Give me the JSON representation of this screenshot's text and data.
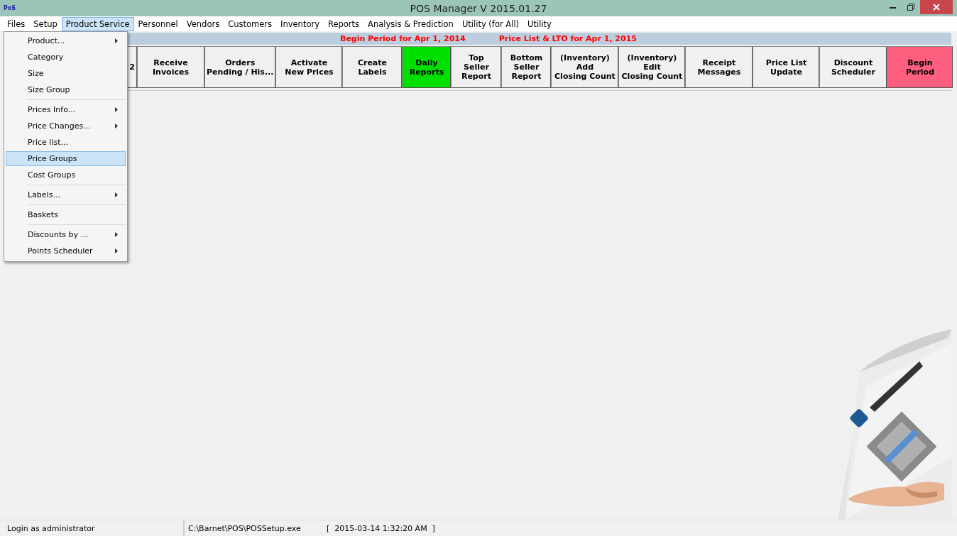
{
  "window": {
    "app_icon": "PoS",
    "title": "POS Manager V 2015.01.27"
  },
  "menu_bar": [
    {
      "label": "Files",
      "selected": false
    },
    {
      "label": "Setup",
      "selected": false
    },
    {
      "label": "Product Service",
      "selected": true
    },
    {
      "label": "Personnel",
      "selected": false
    },
    {
      "label": "Vendors",
      "selected": false
    },
    {
      "label": "Customers",
      "selected": false
    },
    {
      "label": "Inventory",
      "selected": false
    },
    {
      "label": "Reports",
      "selected": false
    },
    {
      "label": "Analysis & Prediction",
      "selected": false
    },
    {
      "label": "Utility (for All)",
      "selected": false
    },
    {
      "label": "Utility",
      "selected": false
    }
  ],
  "dropdown": {
    "groups": [
      [
        {
          "label": "Product...",
          "submenu": true,
          "selected": false
        },
        {
          "label": "Category",
          "submenu": false,
          "selected": false
        },
        {
          "label": "Size",
          "submenu": false,
          "selected": false
        },
        {
          "label": "Size Group",
          "submenu": false,
          "selected": false
        }
      ],
      [
        {
          "label": "Prices Info...",
          "submenu": true,
          "selected": false
        },
        {
          "label": "Price Changes...",
          "submenu": true,
          "selected": false
        },
        {
          "label": "Price list...",
          "submenu": false,
          "selected": false
        },
        {
          "label": "Price Groups",
          "submenu": false,
          "selected": true
        },
        {
          "label": "Cost Groups",
          "submenu": false,
          "selected": false
        }
      ],
      [
        {
          "label": "Labels...",
          "submenu": true,
          "selected": false
        }
      ],
      [
        {
          "label": "Baskets",
          "submenu": false,
          "selected": false
        }
      ],
      [
        {
          "label": "Discounts by ...",
          "submenu": true,
          "selected": false
        },
        {
          "label": "Points Scheduler",
          "submenu": true,
          "selected": false
        }
      ]
    ]
  },
  "banner": [
    "Begin Period for  Apr 1, 2014",
    "Price List & LTO for  Apr 1, 2015"
  ],
  "toolbar": [
    {
      "lines": [
        "2"
      ],
      "color": "#f0f0f0"
    },
    {
      "lines": [
        "Receive",
        "Invoices"
      ],
      "color": "#f0f0f0"
    },
    {
      "lines": [
        "Orders",
        "Pending / His..."
      ],
      "color": "#f0f0f0"
    },
    {
      "lines": [
        "Activate",
        "New Prices"
      ],
      "color": "#f0f0f0"
    },
    {
      "lines": [
        "Create",
        "Labels"
      ],
      "color": "#f0f0f0"
    },
    {
      "lines": [
        "Daily",
        "Reports"
      ],
      "color": "#00e000"
    },
    {
      "lines": [
        "Top",
        "Seller",
        "Report"
      ],
      "color": "#f0f0f0"
    },
    {
      "lines": [
        "Bottom",
        "Seller",
        "Report"
      ],
      "color": "#f0f0f0"
    },
    {
      "lines": [
        "(Inventory)",
        "Add",
        "Closing Count"
      ],
      "color": "#f0f0f0"
    },
    {
      "lines": [
        "(Inventory)",
        "Edit",
        "Closing Count"
      ],
      "color": "#f0f0f0"
    },
    {
      "lines": [
        "Receipt",
        "Messages"
      ],
      "color": "#f0f0f0"
    },
    {
      "lines": [
        "Price List",
        "Update"
      ],
      "color": "#f0f0f0"
    },
    {
      "lines": [
        "Discount",
        "Scheduler"
      ],
      "color": "#f0f0f0"
    },
    {
      "lines": [
        "Begin",
        "Period"
      ],
      "color": "#ff5f7e"
    }
  ],
  "main": {
    "kind": "picture"
  },
  "status_bar": [
    "Login as administrator",
    "C:\\Barnet\\POS\\POSSetup.exe",
    "[  2015-03-14 1:32:20 AM  ]"
  ]
}
